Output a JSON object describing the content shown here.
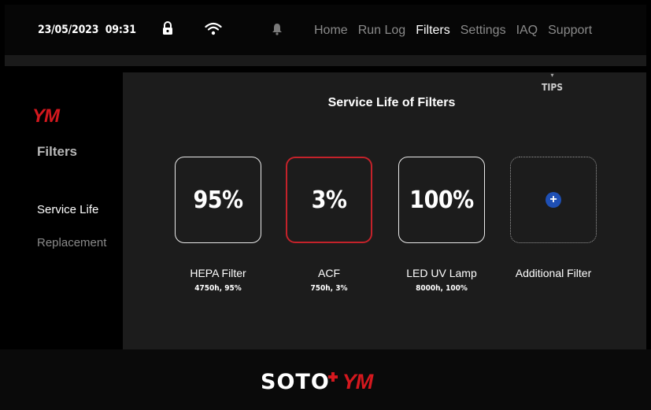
{
  "header": {
    "date": "23/05/2023",
    "time": "09:31",
    "nav": [
      "Home",
      "Run Log",
      "Filters",
      "Settings",
      "IAQ",
      "Support"
    ],
    "active_nav": "Filters"
  },
  "sidebar": {
    "logo": "YM",
    "title": "Filters",
    "items": [
      "Service Life",
      "Replacement"
    ]
  },
  "main": {
    "tips": "TIPS",
    "title": "Service Life of Filters",
    "filters": [
      {
        "value": "95%",
        "name": "HEPA Filter",
        "detail": "4750h, 95%"
      },
      {
        "value": "3%",
        "name": "ACF",
        "detail": "750h, 3%"
      },
      {
        "value": "100%",
        "name": "LED UV Lamp",
        "detail": "8000h, 100%"
      }
    ],
    "add": {
      "symbol": "+",
      "name": "Additional Filter"
    }
  },
  "footer": {
    "brand1": "SOTO",
    "brand2": "YM"
  },
  "colors": {
    "accent": "#d4181e",
    "plus": "#1e4fb4",
    "panel": "#1c1c1c"
  }
}
